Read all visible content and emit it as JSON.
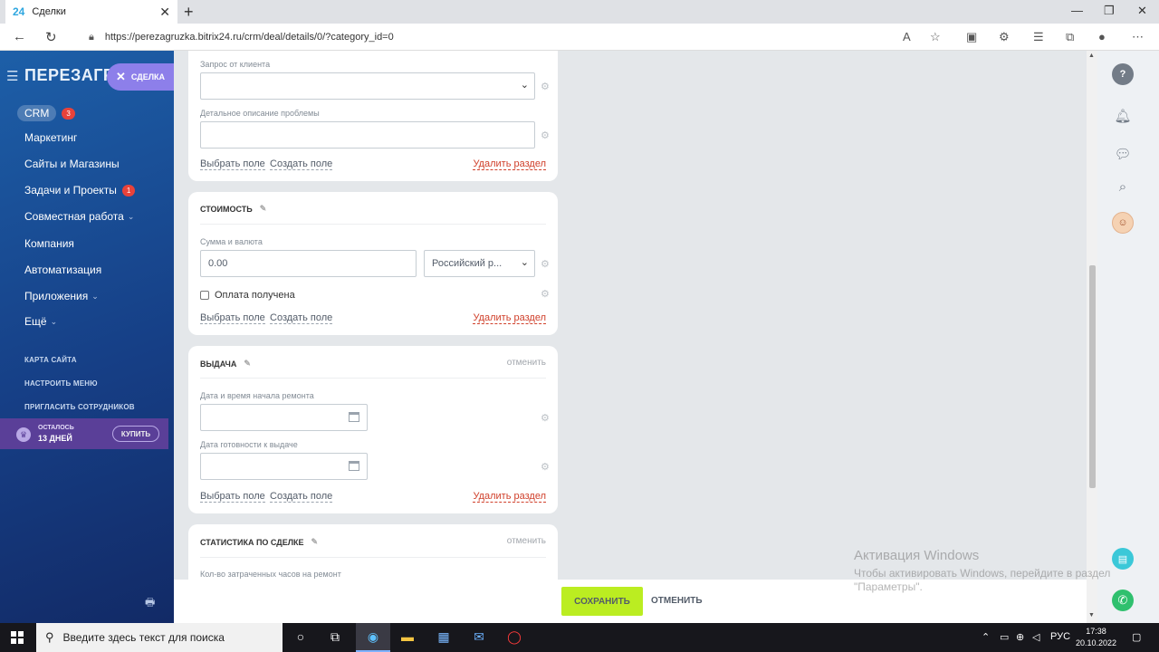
{
  "browser": {
    "tab_title": "Сделки",
    "tab_favicon": "24",
    "url": "https://perezagruzka.bitrix24.ru/crm/deal/details/0/?category_id=0"
  },
  "sidebar": {
    "brand": "ПЕРЕЗАГРУ",
    "deal_pill": "СДЕЛКА",
    "items": [
      {
        "label": "CRM",
        "badge": "3"
      },
      {
        "label": "Маркетинг"
      },
      {
        "label": "Сайты и Магазины"
      },
      {
        "label": "Задачи и Проекты",
        "badge": "1"
      },
      {
        "label": "Совместная работа"
      },
      {
        "label": "Компания"
      },
      {
        "label": "Автоматизация"
      },
      {
        "label": "Приложения"
      },
      {
        "label": "Ещё"
      }
    ],
    "links": [
      "КАРТА САЙТА",
      "НАСТРОИТЬ МЕНЮ",
      "ПРИГЛАСИТЬ СОТРУДНИКОВ"
    ],
    "trial": {
      "line1": "ОСТАЛОСЬ",
      "line2": "13 ДНЕЙ",
      "buy": "КУПИТЬ"
    }
  },
  "card1": {
    "field1_label": "Запрос от клиента",
    "field2_label": "Детальное описание проблемы",
    "select_field": "Выбрать поле",
    "create_field": "Создать поле",
    "delete_section": "Удалить раздел"
  },
  "card2": {
    "title": "СТОИМОСТЬ",
    "field_label": "Сумма и валюта",
    "amount": "0.00",
    "currency": "Российский р...",
    "checkbox_label": "Оплата получена",
    "select_field": "Выбрать поле",
    "create_field": "Создать поле",
    "delete_section": "Удалить раздел"
  },
  "card3": {
    "title": "ВЫДАЧА",
    "cancel": "отменить",
    "field1_label": "Дата и время начала ремонта",
    "field2_label": "Дата готовности к выдаче",
    "select_field": "Выбрать поле",
    "create_field": "Создать поле",
    "delete_section": "Удалить раздел"
  },
  "card4": {
    "title": "СТАТИСТИКА ПО СДЕЛКЕ",
    "cancel": "отменить",
    "field1_label": "Кол-во затраченных часов на ремонт"
  },
  "actions": {
    "save": "СОХРАНИТЬ",
    "cancel": "ОТМЕНИТЬ"
  },
  "watermark": {
    "line1": "Активация Windows",
    "line2": "Чтобы активировать Windows, перейдите в раздел",
    "line3": "\"Параметры\"."
  },
  "taskbar": {
    "search_placeholder": "Введите здесь текст для поиска",
    "lang": "РУС",
    "time": "17:38",
    "date": "20.10.2022"
  },
  "colors": {
    "sidebar": "#163f86",
    "save_button": "#bbed21",
    "danger_link": "#d0402b"
  }
}
